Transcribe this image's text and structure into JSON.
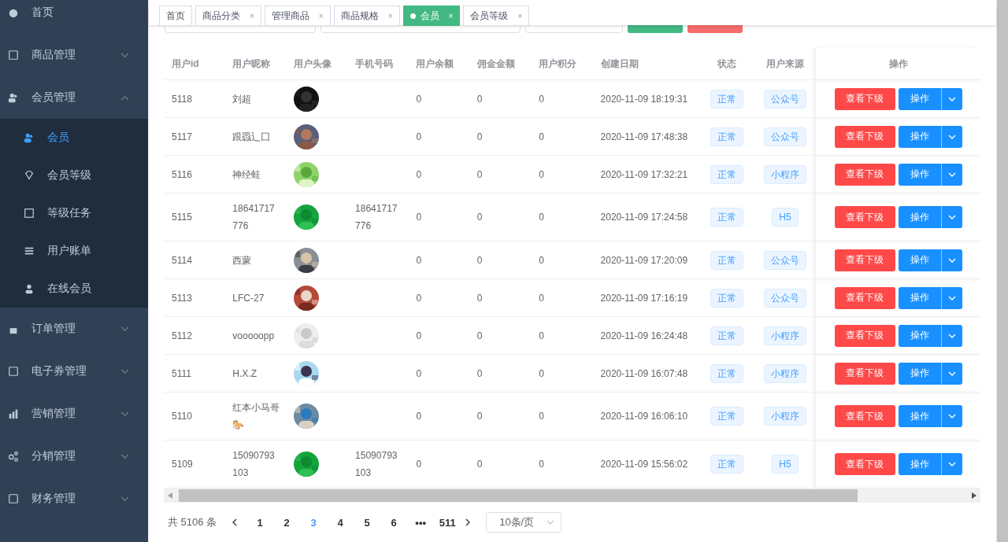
{
  "sidebar": {
    "items": [
      {
        "label": "首页"
      },
      {
        "label": "商品管理",
        "expanded": false
      },
      {
        "label": "会员管理",
        "expanded": true,
        "children": [
          {
            "label": "会员",
            "selected": true
          },
          {
            "label": "会员等级",
            "selected": false
          },
          {
            "label": "等级任务",
            "selected": false
          },
          {
            "label": "用户账单",
            "selected": false
          },
          {
            "label": "在线会员",
            "selected": false
          }
        ]
      },
      {
        "label": "订单管理",
        "expanded": false
      },
      {
        "label": "电子券管理",
        "expanded": false
      },
      {
        "label": "营销管理",
        "expanded": false
      },
      {
        "label": "分销管理",
        "expanded": false
      },
      {
        "label": "财务管理",
        "expanded": false
      }
    ]
  },
  "tabs": [
    {
      "label": "首页",
      "selected": false
    },
    {
      "label": "商品分类",
      "selected": false,
      "close": "×"
    },
    {
      "label": "管理商品",
      "selected": false,
      "close": "×"
    },
    {
      "label": "商品规格",
      "selected": false,
      "close": "×"
    },
    {
      "label": "会员",
      "selected": true,
      "close": "×"
    },
    {
      "label": "会员等级",
      "selected": false,
      "close": "×"
    }
  ],
  "table": {
    "columns": [
      "用户id",
      "用户昵称",
      "用户头像",
      "手机号码",
      "用户余额",
      "佣金金额",
      "用户积分",
      "创建日期",
      "状态",
      "用户来源",
      "操作"
    ],
    "rows": [
      {
        "id": "5118",
        "nickname": "刘超",
        "balance": "0",
        "commission": "0",
        "points": "0",
        "created": "2020-11-09 18:19:31",
        "status": "正常",
        "source": "公众号",
        "view": "查看下级",
        "op": "操作"
      },
      {
        "id": "5117",
        "nickname": "跟羉辶⼞",
        "balance": "0",
        "commission": "0",
        "points": "0",
        "created": "2020-11-09 17:48:38",
        "status": "正常",
        "source": "公众号",
        "view": "查看下级",
        "op": "操作"
      },
      {
        "id": "5116",
        "nickname": "神经蛙",
        "balance": "0",
        "commission": "0",
        "points": "0",
        "created": "2020-11-09 17:32:21",
        "status": "正常",
        "source": "小程序",
        "view": "查看下级",
        "op": "操作"
      },
      {
        "id": "5115",
        "nickname": "18641717776",
        "phone": "18641717776",
        "balance": "0",
        "commission": "0",
        "points": "0",
        "created": "2020-11-09 17:24:58",
        "status": "正常",
        "source": "H5",
        "view": "查看下级",
        "op": "操作"
      },
      {
        "id": "5114",
        "nickname": "西蒙",
        "balance": "0",
        "commission": "0",
        "points": "0",
        "created": "2020-11-09 17:20:09",
        "status": "正常",
        "source": "公众号",
        "view": "查看下级",
        "op": "操作"
      },
      {
        "id": "5113",
        "nickname": "LFC-27",
        "balance": "0",
        "commission": "0",
        "points": "0",
        "created": "2020-11-09 17:16:19",
        "status": "正常",
        "source": "公众号",
        "view": "查看下级",
        "op": "操作"
      },
      {
        "id": "5112",
        "nickname": "vooooopp",
        "balance": "0",
        "commission": "0",
        "points": "0",
        "created": "2020-11-09 16:24:48",
        "status": "正常",
        "source": "小程序",
        "view": "查看下级",
        "op": "操作"
      },
      {
        "id": "5111",
        "nickname": "H.X.Z",
        "balance": "0",
        "commission": "0",
        "points": "0",
        "created": "2020-11-09 16:07:48",
        "status": "正常",
        "source": "小程序",
        "view": "查看下级",
        "op": "操作"
      },
      {
        "id": "5110",
        "nickname": "红本小马哥🐎",
        "balance": "0",
        "commission": "0",
        "points": "0",
        "created": "2020-11-09 16:06:10",
        "status": "正常",
        "source": "小程序",
        "view": "查看下级",
        "op": "操作"
      },
      {
        "id": "5109",
        "nickname": "15090793103",
        "phone": "15090793103",
        "balance": "0",
        "commission": "0",
        "points": "0",
        "created": "2020-11-09 15:56:02",
        "status": "正常",
        "source": "H5",
        "view": "查看下级",
        "op": "操作"
      }
    ]
  },
  "pagination": {
    "total": "共 5106 条",
    "pages": [
      {
        "label": "1",
        "selected": false
      },
      {
        "label": "2",
        "selected": false
      },
      {
        "label": "3",
        "selected": true
      },
      {
        "label": "4",
        "selected": false
      },
      {
        "label": "5",
        "selected": false
      },
      {
        "label": "6",
        "selected": false
      },
      {
        "label": "•••",
        "selected": false
      },
      {
        "label": "511",
        "selected": false
      }
    ],
    "page_size": "10条/页"
  }
}
